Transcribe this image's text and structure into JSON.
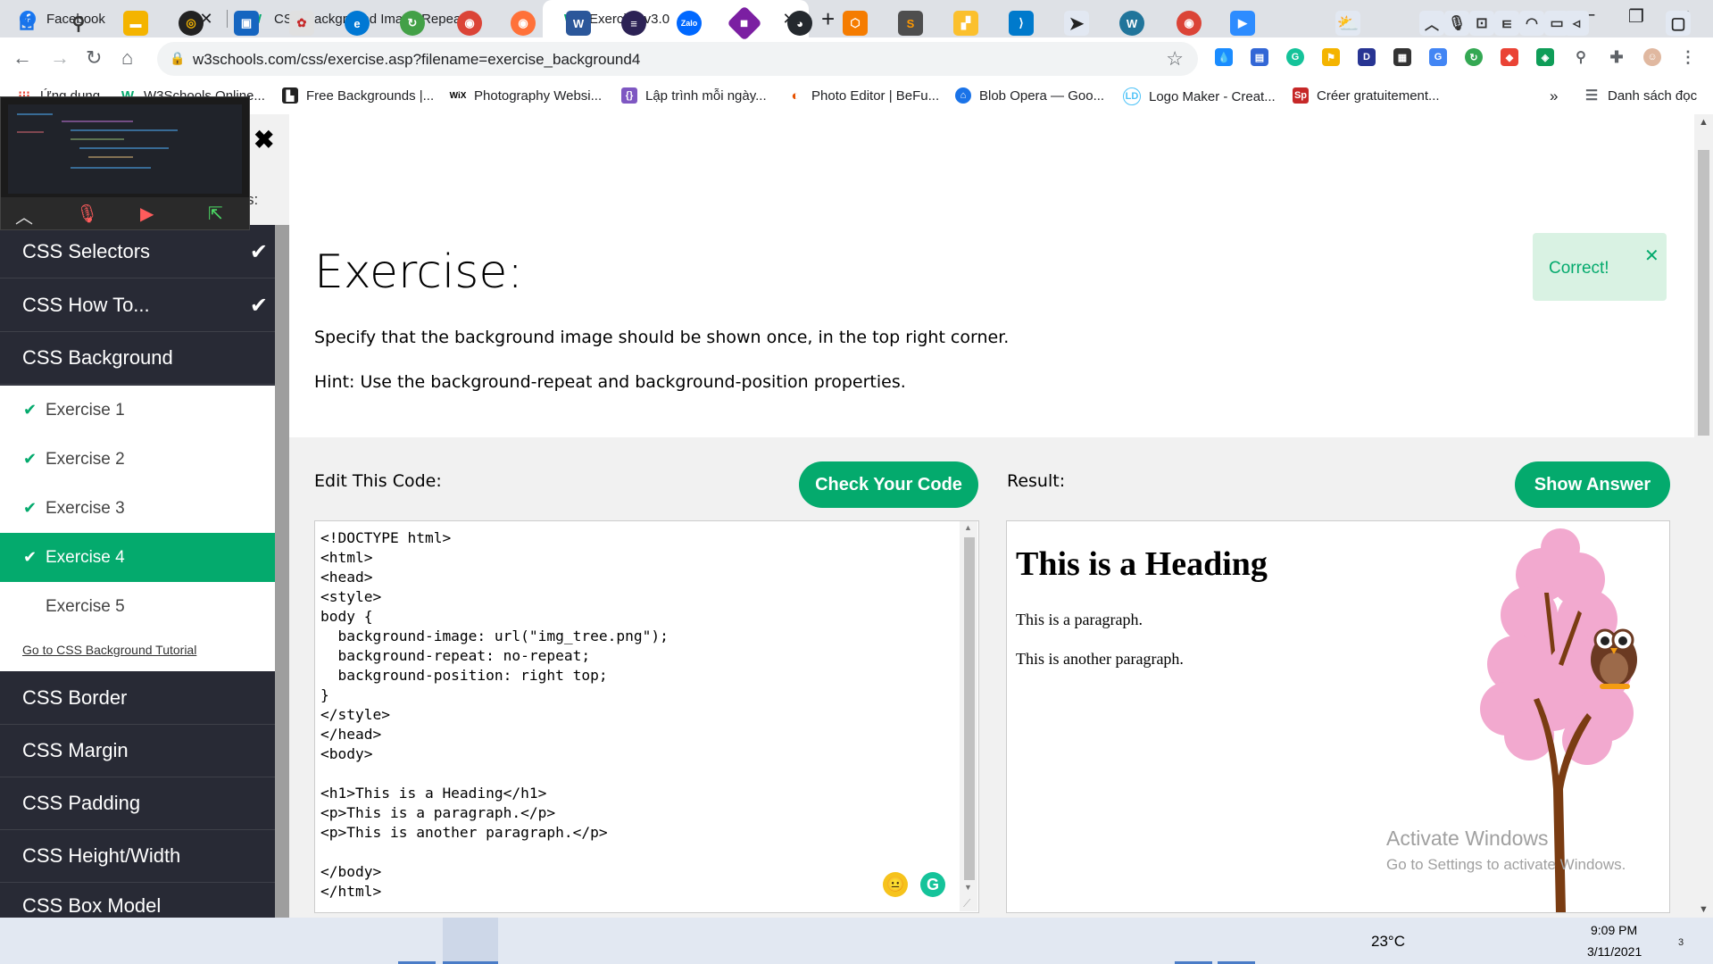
{
  "browser": {
    "tabs": [
      {
        "title": "Facebook",
        "icon": "facebook-icon",
        "color": "#1877f2"
      },
      {
        "title": "CSS Background Image Repeat",
        "icon": "w3schools-icon",
        "color": "#04aa6d"
      },
      {
        "title": "Exercise v3.0",
        "icon": "w3schools-icon",
        "color": "#04aa6d",
        "active": true
      }
    ],
    "url": "w3schools.com/css/exercise.asp?filename=exercise_background4",
    "bookmarks": [
      "Ứng dụng",
      "W3Schools Online...",
      "Free Backgrounds |...",
      "Photography Websi...",
      "Lập trình mỗi ngày...",
      "Photo Editor | BeFu...",
      "Blob Opera — Goo...",
      "Logo Maker - Creat...",
      "Créer gratuitement...",
      "Danh sách đọc"
    ]
  },
  "sidebar": {
    "partial_text": "s:",
    "top_sections": [
      {
        "label": "CSS Selectors",
        "done": true
      },
      {
        "label": "CSS How To...",
        "done": true
      },
      {
        "label": "CSS Background",
        "done": false
      }
    ],
    "exercises": [
      {
        "label": "Exercise 1",
        "done": true
      },
      {
        "label": "Exercise 2",
        "done": true
      },
      {
        "label": "Exercise 3",
        "done": true
      },
      {
        "label": "Exercise 4",
        "done": true,
        "active": true
      },
      {
        "label": "Exercise 5",
        "done": false
      }
    ],
    "tutorial_link": "Go to CSS Background Tutorial",
    "bottom_sections": [
      "CSS Border",
      "CSS Margin",
      "CSS Padding",
      "CSS Height/Width",
      "CSS Box Model"
    ]
  },
  "main": {
    "title": "Exercise:",
    "instruction": "Specify that the background image should be shown once, in the top right corner.",
    "hint": "Hint: Use the background-repeat and background-position properties.",
    "correct_label": "Correct!",
    "edit_label": "Edit This Code:",
    "check_button": "Check Your Code",
    "result_label": "Result:",
    "answer_button": "Show Answer",
    "code": "<!DOCTYPE html>\n<html>\n<head>\n<style>\nbody {\n  background-image: url(\"img_tree.png\");\n  background-repeat: no-repeat;\n  background-position: right top;\n}\n</style>\n</head>\n<body>\n\n<h1>This is a Heading</h1>\n<p>This is a paragraph.</p>\n<p>This is another paragraph.</p>\n\n</body>\n</html>",
    "result": {
      "heading": "This is a Heading",
      "p1": "This is a paragraph.",
      "p2": "This is another paragraph."
    },
    "watermark_title": "Activate Windows",
    "watermark_sub": "Go to Settings to activate Windows."
  },
  "taskbar": {
    "temperature": "23°C",
    "time": "9:09 PM",
    "date": "3/11/2021",
    "notification_count": "3"
  },
  "colors": {
    "accent": "#04aa6d",
    "sidebar_dark": "#282a35"
  }
}
